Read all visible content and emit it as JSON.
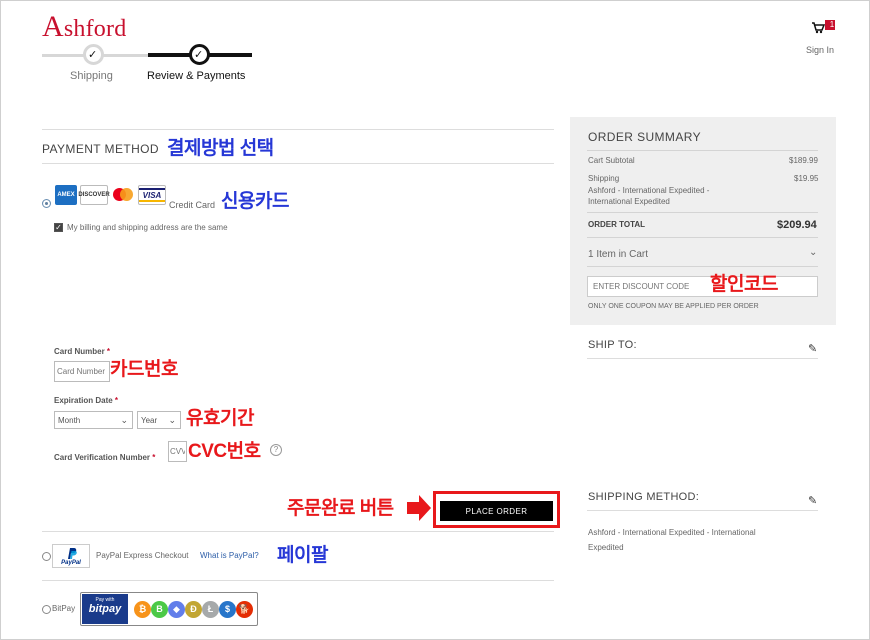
{
  "header": {
    "logo_lead": "A",
    "logo_rest": "shford",
    "cart_count": "1",
    "sign_in": "Sign In"
  },
  "progress": {
    "steps": [
      {
        "label": "Shipping",
        "state": "complete"
      },
      {
        "label": "Review & Payments",
        "state": "current"
      }
    ],
    "check_glyph": "✓"
  },
  "payment": {
    "title": "PAYMENT METHOD",
    "annotation_title": "결제방법 선택",
    "credit_card": {
      "label": "Credit Card",
      "annotation": "신용카드",
      "selected": true,
      "logos": [
        "AMEX",
        "DISCOVER",
        "mastercard",
        "VISA"
      ],
      "billing_same_label": "My billing and shipping address are the same",
      "billing_same_checked": true,
      "card_number_label": "Card Number",
      "card_number_placeholder": "Card Number",
      "card_number_annotation": "카드번호",
      "expiration_label": "Expiration Date",
      "month_value": "Month",
      "year_value": "Year",
      "expiration_annotation": "유효기간",
      "cvv_label": "Card Verification Number",
      "cvv_placeholder": "CVV",
      "cvv_annotation": "CVC번호",
      "help_glyph": "?",
      "required_mark": "*"
    },
    "place_order": {
      "label": "PLACE ORDER",
      "annotation": "주문완료 버튼"
    },
    "paypal": {
      "logo_text": "PayPal",
      "label": "PayPal Express Checkout",
      "link": "What is PayPal?",
      "annotation": "페이팔"
    },
    "bitpay": {
      "label": "BitPay",
      "pay_with": "Pay with",
      "brand": "bitpay",
      "coins": [
        {
          "symbol": "₿",
          "color": "#f7931a"
        },
        {
          "symbol": "B",
          "color": "#4cc947"
        },
        {
          "symbol": "◆",
          "color": "#627eea"
        },
        {
          "symbol": "Ð",
          "color": "#c2a633"
        },
        {
          "symbol": "Ł",
          "color": "#a6a9aa"
        },
        {
          "symbol": "$",
          "color": "#2775ca"
        },
        {
          "symbol": "🐕",
          "color": "#e42d04"
        }
      ]
    }
  },
  "summary": {
    "title": "ORDER SUMMARY",
    "cart_subtotal_label": "Cart Subtotal",
    "cart_subtotal_value": "$189.99",
    "shipping_label": "Shipping",
    "shipping_method": "Ashford - International Expedited - International Expedited",
    "shipping_value": "$19.95",
    "order_total_label": "ORDER TOTAL",
    "order_total_value": "$209.94",
    "items_in_cart": "1 Item in Cart",
    "discount_placeholder": "ENTER DISCOUNT CODE",
    "discount_annotation": "할인코드",
    "coupon_note": "ONLY ONE COUPON MAY BE APPLIED PER ORDER"
  },
  "ship_to": {
    "title": "SHIP TO:"
  },
  "shipping_method": {
    "title": "SHIPPING METHOD:",
    "value": "Ashford - International Expedited - International Expedited"
  }
}
